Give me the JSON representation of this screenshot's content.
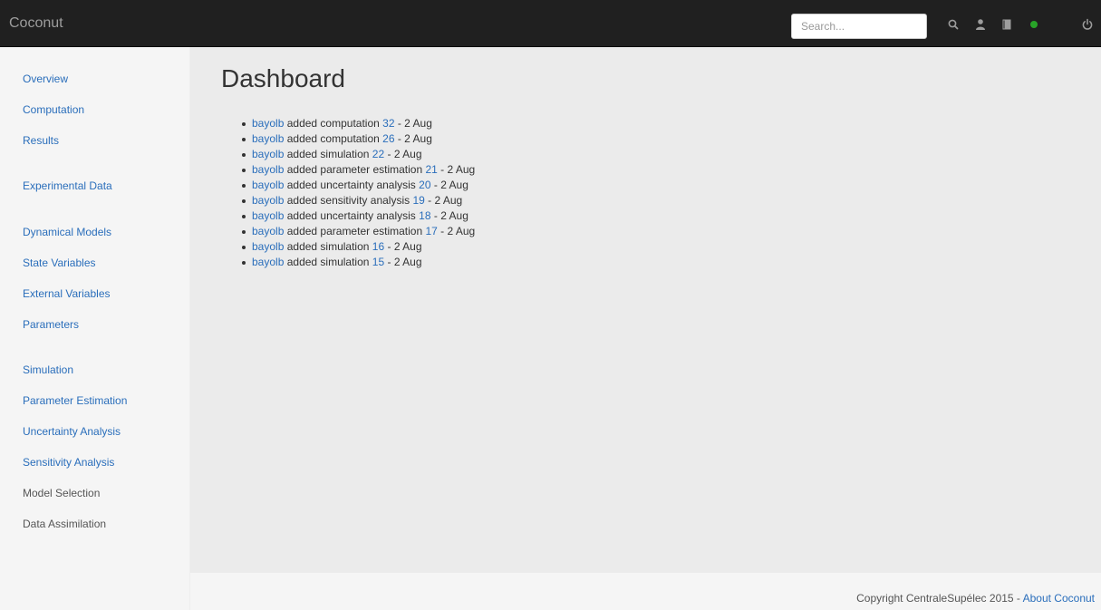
{
  "navbar": {
    "brand": "Coconut",
    "search_placeholder": "Search...",
    "icons": [
      "search-icon",
      "user-icon",
      "book-icon",
      "status-dot-icon",
      "power-icon"
    ],
    "status_color": "#28a428"
  },
  "sidebar": {
    "items": [
      {
        "label": "Overview",
        "enabled": true
      },
      {
        "label": "Computation",
        "enabled": true
      },
      {
        "label": "Results",
        "enabled": true
      },
      {
        "label": "Experimental Data",
        "enabled": true
      },
      {
        "label": "Dynamical Models",
        "enabled": true
      },
      {
        "label": "State Variables",
        "enabled": true
      },
      {
        "label": "External Variables",
        "enabled": true
      },
      {
        "label": "Parameters",
        "enabled": true
      },
      {
        "label": "Simulation",
        "enabled": true
      },
      {
        "label": "Parameter Estimation",
        "enabled": true
      },
      {
        "label": "Uncertainty Analysis",
        "enabled": true
      },
      {
        "label": "Sensitivity Analysis",
        "enabled": true
      },
      {
        "label": "Model Selection",
        "enabled": false
      },
      {
        "label": "Data Assimilation",
        "enabled": false
      }
    ]
  },
  "main": {
    "title": "Dashboard",
    "activity": [
      {
        "user": "bayolb",
        "action": "added computation",
        "id": "32",
        "date": "2 Aug"
      },
      {
        "user": "bayolb",
        "action": "added computation",
        "id": "26",
        "date": "2 Aug"
      },
      {
        "user": "bayolb",
        "action": "added simulation",
        "id": "22",
        "date": "2 Aug"
      },
      {
        "user": "bayolb",
        "action": "added parameter estimation",
        "id": "21",
        "date": "2 Aug"
      },
      {
        "user": "bayolb",
        "action": "added uncertainty analysis",
        "id": "20",
        "date": "2 Aug"
      },
      {
        "user": "bayolb",
        "action": "added sensitivity analysis",
        "id": "19",
        "date": "2 Aug"
      },
      {
        "user": "bayolb",
        "action": "added uncertainty analysis",
        "id": "18",
        "date": "2 Aug"
      },
      {
        "user": "bayolb",
        "action": "added parameter estimation",
        "id": "17",
        "date": "2 Aug"
      },
      {
        "user": "bayolb",
        "action": "added simulation",
        "id": "16",
        "date": "2 Aug"
      },
      {
        "user": "bayolb",
        "action": "added simulation",
        "id": "15",
        "date": "2 Aug"
      }
    ]
  },
  "footer": {
    "copyright": "Copyright CentraleSupélec 2015",
    "separator": " - ",
    "about_label": "About Coconut"
  },
  "colors": {
    "navbar_bg": "#202020",
    "link": "#2a6ebb",
    "sidebar_bg": "#f5f5f5",
    "content_bg": "#ebebeb"
  }
}
